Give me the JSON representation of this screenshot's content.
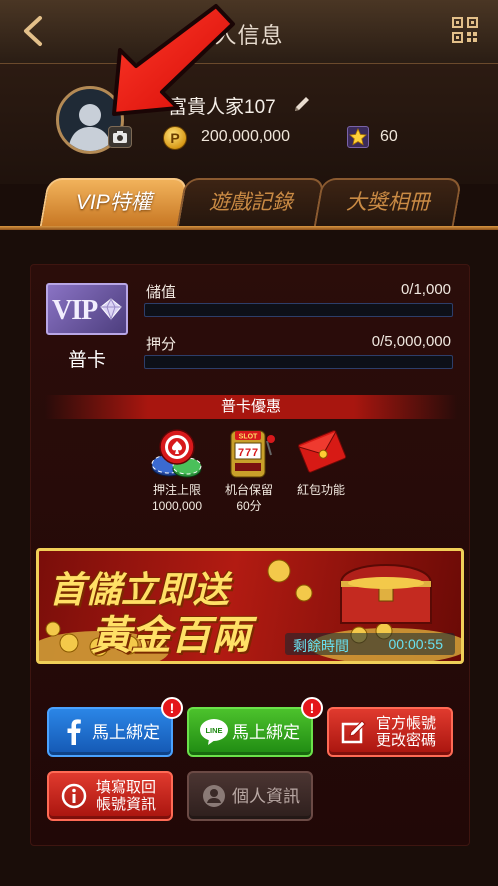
{
  "header": {
    "title": "人信息",
    "back_icon": "chevron-left-icon",
    "qr_icon": "qr-code-icon"
  },
  "profile": {
    "nickname": "富貴人家107",
    "coins": "200,000,000",
    "coin_symbol": "P",
    "stars": "60"
  },
  "tabs": [
    {
      "label": "VIP特權",
      "active": true
    },
    {
      "label": "遊戲記錄",
      "active": false
    },
    {
      "label": "大獎相冊",
      "active": false
    }
  ],
  "vip": {
    "badge_text": "VIP",
    "card_name": "普卡",
    "stored_value": {
      "label": "儲值",
      "value": "0/1,000",
      "progress": 0
    },
    "betting": {
      "label": "押分",
      "value": "0/5,000,000",
      "progress": 0
    }
  },
  "perks": {
    "header": "普卡優惠",
    "items": [
      {
        "line1": "押注上限",
        "line2": "1000,000",
        "icon": "poker-chip-icon"
      },
      {
        "line1": "机台保留",
        "line2": "60分",
        "icon": "slot-machine-icon"
      },
      {
        "line1": "紅包功能",
        "line2": "",
        "icon": "red-envelope-icon"
      }
    ],
    "slot_text": "SLOT"
  },
  "banner": {
    "line1": "首儲立即送",
    "line2": "黃金百兩",
    "timer_label": "剩餘時間",
    "timer_value": "00:00:55"
  },
  "buttons": {
    "facebook": {
      "label": "馬上綁定",
      "badge": "!"
    },
    "line": {
      "label": "馬上綁定",
      "badge": "!",
      "icon_text": "LINE"
    },
    "change_password": {
      "label_line1": "官方帳號",
      "label_line2": "更改密碼"
    },
    "recovery": {
      "label_line1": "填寫取回",
      "label_line2": "帳號資訊"
    },
    "personal": {
      "label": "個人資訊"
    }
  },
  "colors": {
    "accent_gold": "#f1b25b",
    "facebook_blue": "#1458b3",
    "line_green": "#1f8a12",
    "red": "#a8140e",
    "arrow_red": "#ff1a10"
  }
}
